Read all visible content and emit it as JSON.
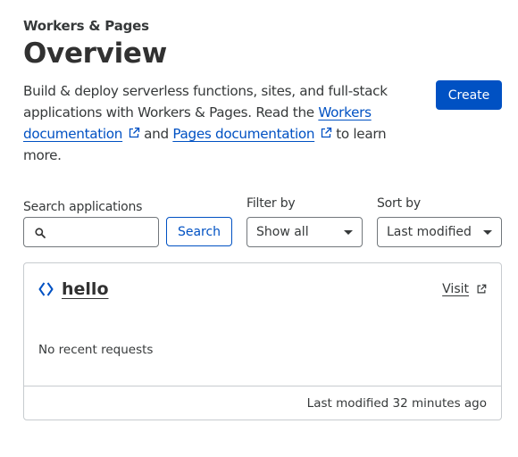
{
  "header": {
    "eyebrow": "Workers & Pages",
    "title": "Overview",
    "description_part1": "Build & deploy serverless functions, sites, and full-stack applications with Workers & Pages. Read the ",
    "workers_docs_link": "Workers documentation",
    "description_part2": "and ",
    "pages_docs_link": "Pages documentation",
    "description_part3": "to learn more.",
    "create_label": "Create"
  },
  "controls": {
    "search_label": "Search applications",
    "search_value": "",
    "search_button": "Search",
    "filter_label": "Filter by",
    "filter_value": "Show all",
    "sort_label": "Sort by",
    "sort_value": "Last modified"
  },
  "applications": [
    {
      "name": "hello",
      "visit_label": "Visit",
      "status": "No recent requests",
      "last_modified": "Last modified 32 minutes ago"
    }
  ],
  "colors": {
    "accent": "#0051c3",
    "text": "#36393a",
    "border": "#c7cbcf"
  },
  "icons": {
    "external_link": "external-link-icon",
    "search": "search-icon",
    "worker": "worker-icon",
    "dropdown": "chevron-down-icon"
  }
}
